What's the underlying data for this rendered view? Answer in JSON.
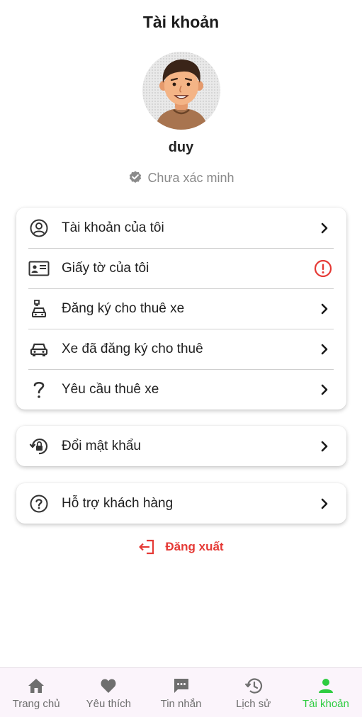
{
  "header": {
    "title": "Tài khoản"
  },
  "profile": {
    "username": "duy",
    "verification_status": "Chưa xác minh"
  },
  "menu_main": [
    {
      "label": "Tài khoản của tôi",
      "icon": "account-circle-icon",
      "trailing": "chevron-right-icon"
    },
    {
      "label": "Giấy tờ của tôi",
      "icon": "id-card-icon",
      "trailing": "warning-icon"
    },
    {
      "label": "Đăng ký cho thuê xe",
      "icon": "car-rental-icon",
      "trailing": "chevron-right-icon"
    },
    {
      "label": "Xe đã đăng ký cho thuê",
      "icon": "car-icon",
      "trailing": "chevron-right-icon"
    },
    {
      "label": "Yêu cầu thuê xe",
      "icon": "question-mark-icon",
      "trailing": "chevron-right-icon"
    }
  ],
  "menu_password": {
    "label": "Đổi mật khẩu",
    "icon": "lock-reset-icon"
  },
  "menu_support": {
    "label": "Hỗ trợ khách hàng",
    "icon": "help-circle-icon"
  },
  "logout": {
    "label": "Đăng xuất",
    "icon": "logout-icon"
  },
  "bottom_nav": [
    {
      "label": "Trang chủ",
      "icon": "home-icon",
      "active": false
    },
    {
      "label": "Yêu thích",
      "icon": "heart-icon",
      "active": false
    },
    {
      "label": "Tin nhắn",
      "icon": "chat-icon",
      "active": false
    },
    {
      "label": "Lịch sử",
      "icon": "history-icon",
      "active": false
    },
    {
      "label": "Tài khoản",
      "icon": "person-icon",
      "active": true
    }
  ],
  "colors": {
    "accent_green": "#2ecc40",
    "danger_red": "#e53935",
    "nav_background": "#fbf4fb",
    "muted_text": "#8a8a8a"
  }
}
